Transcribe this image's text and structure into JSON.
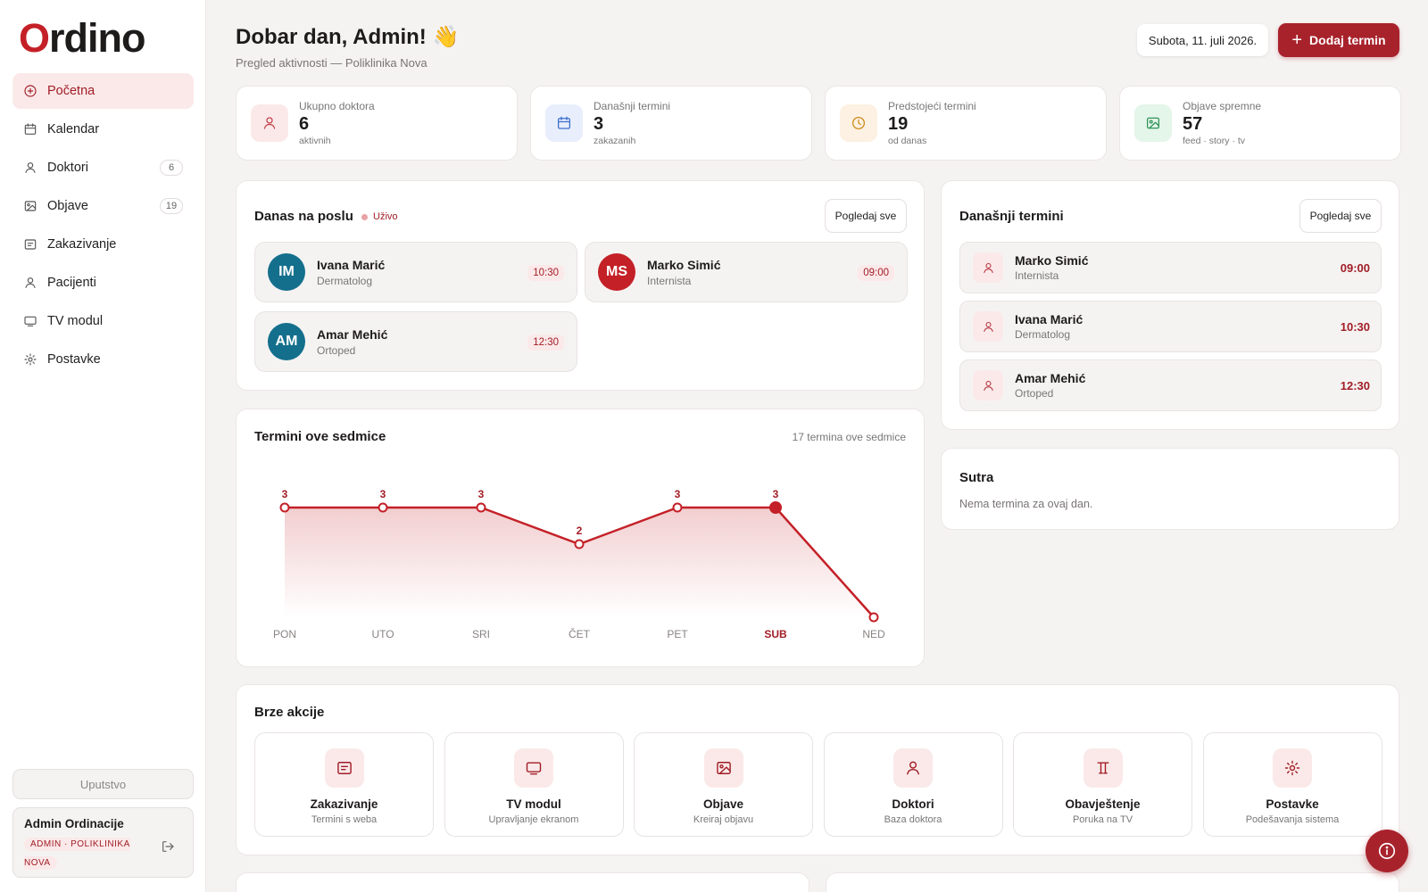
{
  "brand": {
    "logo_accent": "O",
    "logo_rest": "rdino"
  },
  "nav": [
    {
      "label": "Početna",
      "icon": "plus-circle-icon",
      "active": true
    },
    {
      "label": "Kalendar",
      "icon": "calendar-icon"
    },
    {
      "label": "Doktori",
      "icon": "user-icon",
      "badge": "6"
    },
    {
      "label": "Objave",
      "icon": "image-icon",
      "badge": "19"
    },
    {
      "label": "Zakazivanje",
      "icon": "form-icon"
    },
    {
      "label": "Pacijenti",
      "icon": "user-icon"
    },
    {
      "label": "TV modul",
      "icon": "tv-icon"
    },
    {
      "label": "Postavke",
      "icon": "gear-icon"
    }
  ],
  "sidebar_footer": {
    "help_label": "Uputstvo",
    "user_name": "Admin Ordinacije",
    "user_role": "ADMIN · POLIKLINIKA NOVA"
  },
  "header": {
    "title": "Dobar dan, Admin! 👋",
    "subtitle": "Pregled aktivnosti — Poliklinika Nova",
    "date": "Subota, 11. juli 2026.",
    "add_button": "Dodaj termin"
  },
  "stats": [
    {
      "label": "Ukupno doktora",
      "value": "6",
      "sub": "aktivnih",
      "icon": "user-icon",
      "bg": "#fbe9e9",
      "fg": "#c0424a"
    },
    {
      "label": "Današnji termini",
      "value": "3",
      "sub": "zakazanih",
      "icon": "calendar-icon",
      "bg": "#e8eefb",
      "fg": "#3d6fcf"
    },
    {
      "label": "Predstojeći termini",
      "value": "19",
      "sub": "od danas",
      "icon": "clock-icon",
      "bg": "#fcf1e2",
      "fg": "#d08a1c"
    },
    {
      "label": "Objave spremne",
      "value": "57",
      "sub": "feed · story · tv",
      "icon": "image-icon",
      "bg": "#e4f5ea",
      "fg": "#2f9456"
    }
  ],
  "on_duty": {
    "title": "Danas na poslu",
    "live_label": "Uživo",
    "view_all": "Pogledaj sve",
    "staff": [
      {
        "initials": "IM",
        "name": "Ivana Marić",
        "specialty": "Dermatolog",
        "time": "10:30",
        "color": "#146f8d"
      },
      {
        "initials": "MS",
        "name": "Marko Simić",
        "specialty": "Internista",
        "time": "09:00",
        "color": "#c42027"
      },
      {
        "initials": "AM",
        "name": "Amar Mehić",
        "specialty": "Ortoped",
        "time": "12:30",
        "color": "#146f8d"
      }
    ]
  },
  "today": {
    "title": "Današnji termini",
    "view_all": "Pogledaj sve",
    "items": [
      {
        "name": "Marko Simić",
        "specialty": "Internista",
        "time": "09:00"
      },
      {
        "name": "Ivana Marić",
        "specialty": "Dermatolog",
        "time": "10:30"
      },
      {
        "name": "Amar Mehić",
        "specialty": "Ortoped",
        "time": "12:30"
      }
    ]
  },
  "tomorrow": {
    "title": "Sutra",
    "empty": "Nema termina za ovaj dan."
  },
  "week_chart_card": {
    "title": "Termini ove sedmice",
    "summary": "17 termina ove sedmice"
  },
  "chart_data": {
    "type": "area",
    "title": "Termini ove sedmice",
    "categories": [
      "PON",
      "UTO",
      "SRI",
      "ČET",
      "PET",
      "SUB",
      "NED"
    ],
    "values": [
      3,
      3,
      3,
      2,
      3,
      3,
      0
    ],
    "highlight_index": 5,
    "ylim": [
      0,
      3
    ],
    "grid": false,
    "color": "#c42027"
  },
  "quick_actions": {
    "title": "Brze akcije",
    "items": [
      {
        "title": "Zakazivanje",
        "sub": "Termini s weba",
        "icon": "form-icon"
      },
      {
        "title": "TV modul",
        "sub": "Upravljanje ekranom",
        "icon": "tv-icon"
      },
      {
        "title": "Objave",
        "sub": "Kreiraj objavu",
        "icon": "image-icon"
      },
      {
        "title": "Doktori",
        "sub": "Baza doktora",
        "icon": "user-icon"
      },
      {
        "title": "Obavještenje",
        "sub": "Poruka na TV",
        "icon": "text-icon"
      },
      {
        "title": "Postavke",
        "sub": "Podešavanja sistema",
        "icon": "gear-icon"
      }
    ]
  },
  "colors": {
    "accent": "#a8222c",
    "brand_red": "#c42027",
    "teal_avatar": "#146f8d"
  }
}
